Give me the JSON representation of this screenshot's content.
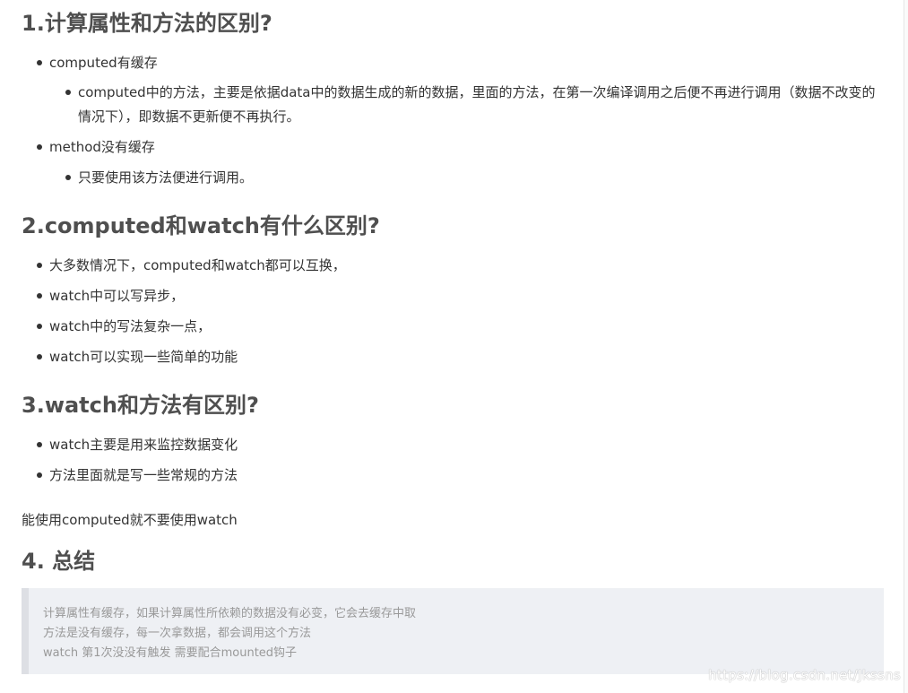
{
  "sections": [
    {
      "heading": "1.计算属性和方法的区别?",
      "items": [
        {
          "text": "computed有缓存",
          "sub": [
            "computed中的方法，主要是依据data中的数据生成的新的数据，里面的方法，在第一次编译调用之后便不再进行调用（数据不改变的情况下），即数据不更新便不再执行。"
          ]
        },
        {
          "text": "method没有缓存",
          "sub": [
            "只要使用该方法便进行调用。"
          ]
        }
      ]
    },
    {
      "heading": "2.computed和watch有什么区别?",
      "items": [
        {
          "text": "大多数情况下，computed和watch都可以互换，"
        },
        {
          "text": "watch中可以写异步，"
        },
        {
          "text": "watch中的写法复杂一点，"
        },
        {
          "text": "watch可以实现一些简单的功能"
        }
      ]
    },
    {
      "heading": "3.watch和方法有区别?",
      "items": [
        {
          "text": "watch主要是用来监控数据变化"
        },
        {
          "text": "方法里面就是写一些常规的方法"
        }
      ]
    },
    {
      "heading": "4. 总结"
    }
  ],
  "paragraph": "能使用computed就不要使用watch",
  "quote": {
    "lines": [
      "计算属性有缓存，如果计算属性所依赖的数据没有必变，它会去缓存中取",
      "方法是没有缓存，每一次拿数据，都会调用这个方法",
      "watch 第1次没没有触发 需要配合mounted钩子"
    ]
  },
  "watermark": "https://blog.csdn.net/Jkssns"
}
